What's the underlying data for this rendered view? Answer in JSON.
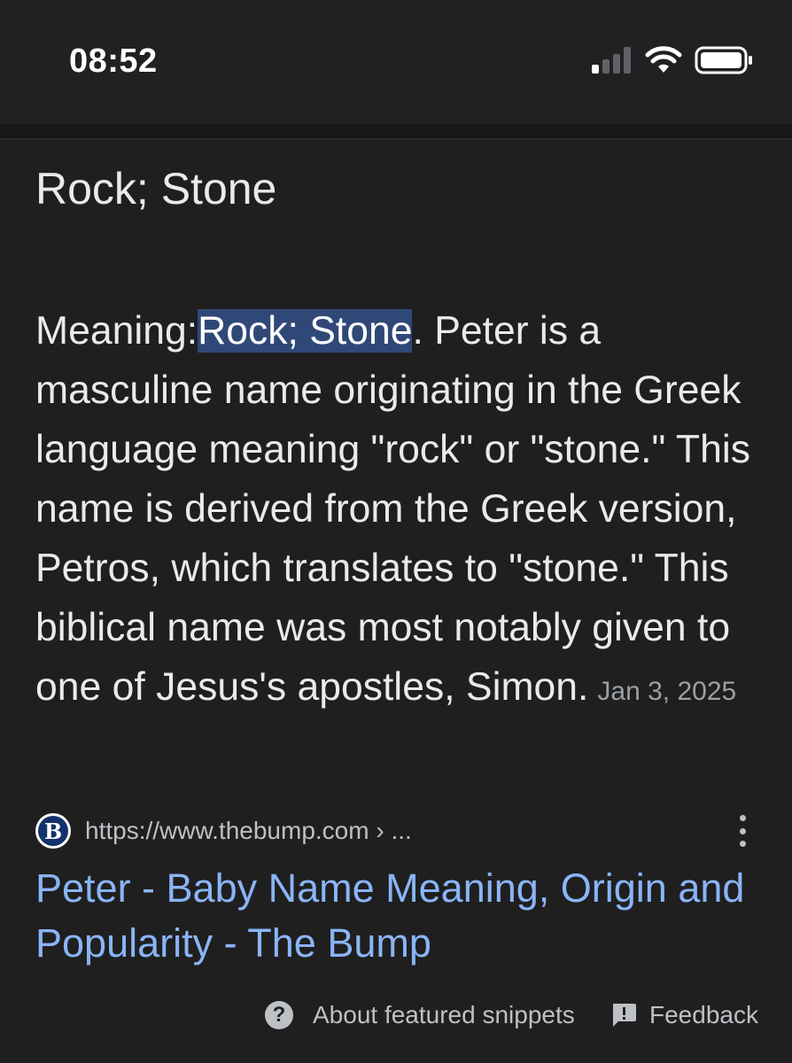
{
  "status_bar": {
    "time": "08:52",
    "icons": [
      "cellular-signal-icon",
      "wifi-icon",
      "battery-icon"
    ]
  },
  "answer": {
    "title": "Rock; Stone"
  },
  "snippet": {
    "lead": "Meaning:",
    "highlighted": "Rock; Stone",
    "body": ". Peter is a masculine name originating in the Greek language meaning \"rock\" or \"stone.\" This name is derived from the Greek version, Petros, which translates to \"stone.\" This biblical name was most notably given to one of Jesus's apostles, Simon.",
    "date": "Jan 3, 2025"
  },
  "source": {
    "favicon_letter": "B",
    "url": "https://www.thebump.com › ...",
    "title": "Peter - Baby Name Meaning, Origin and Popularity - The Bump"
  },
  "footer": {
    "about_label": "About featured snippets",
    "feedback_label": "Feedback"
  },
  "colors": {
    "background": "#1f1f1f",
    "highlight": "#304878",
    "link": "#8ab4f8",
    "muted_text": "#9aa0a6"
  }
}
